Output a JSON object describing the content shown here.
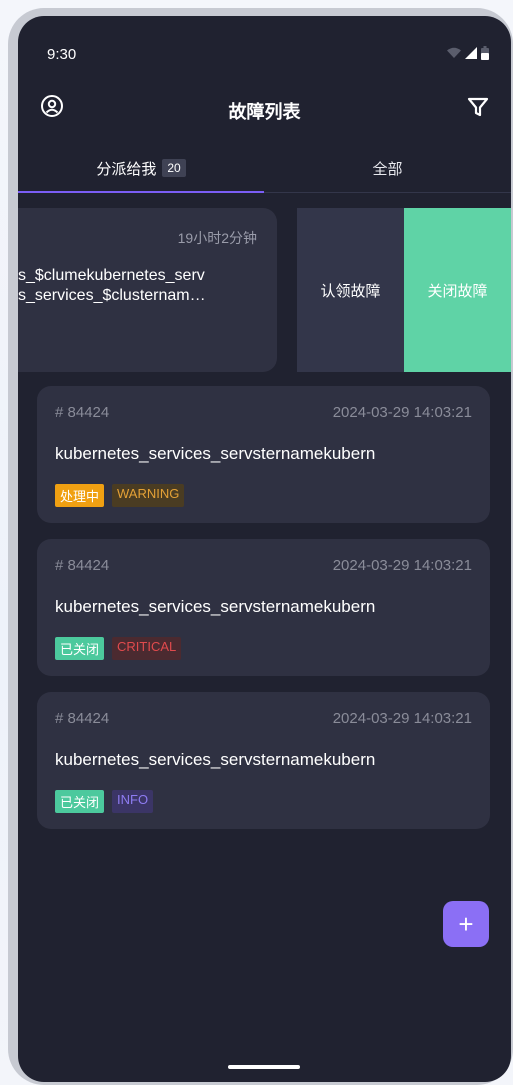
{
  "status_bar": {
    "time": "9:30"
  },
  "header": {
    "title": "故障列表",
    "left_icon": "user-circle-icon",
    "right_icon": "filter-icon"
  },
  "tabs": [
    {
      "label": "分派给我",
      "badge": "20",
      "active": true
    },
    {
      "label": "全部",
      "active": false
    }
  ],
  "swiped_card": {
    "duration": "19小时2分钟",
    "title_line1": "s_$clumekubernetes_serv",
    "title_line2": "s_services_$clusternam…",
    "actions": {
      "claim": "认领故障",
      "close": "关闭故障"
    }
  },
  "incidents": [
    {
      "id": "# 84424",
      "time": "2024-03-29 14:03:21",
      "title": "kubernetes_services_servsternamekubern",
      "status": "处理中",
      "severity": "WARNING"
    },
    {
      "id": "# 84424",
      "time": "2024-03-29 14:03:21",
      "title": "kubernetes_services_servsternamekubern",
      "status": "已关闭",
      "severity": "CRITICAL"
    },
    {
      "id": "# 84424",
      "time": "2024-03-29 14:03:21",
      "title": "kubernetes_services_servsternamekubern",
      "status": "已关闭",
      "severity": "INFO"
    }
  ],
  "fab": {
    "label": "+"
  },
  "colors": {
    "background": "#202230",
    "card": "#2f3142",
    "accent": "#7b5ef6",
    "close_action": "#5fd3a6",
    "processing": "#f0a012",
    "closed": "#4cc99d",
    "warning": "#e4a136",
    "critical": "#e04a4d",
    "info": "#8e7cf2"
  }
}
